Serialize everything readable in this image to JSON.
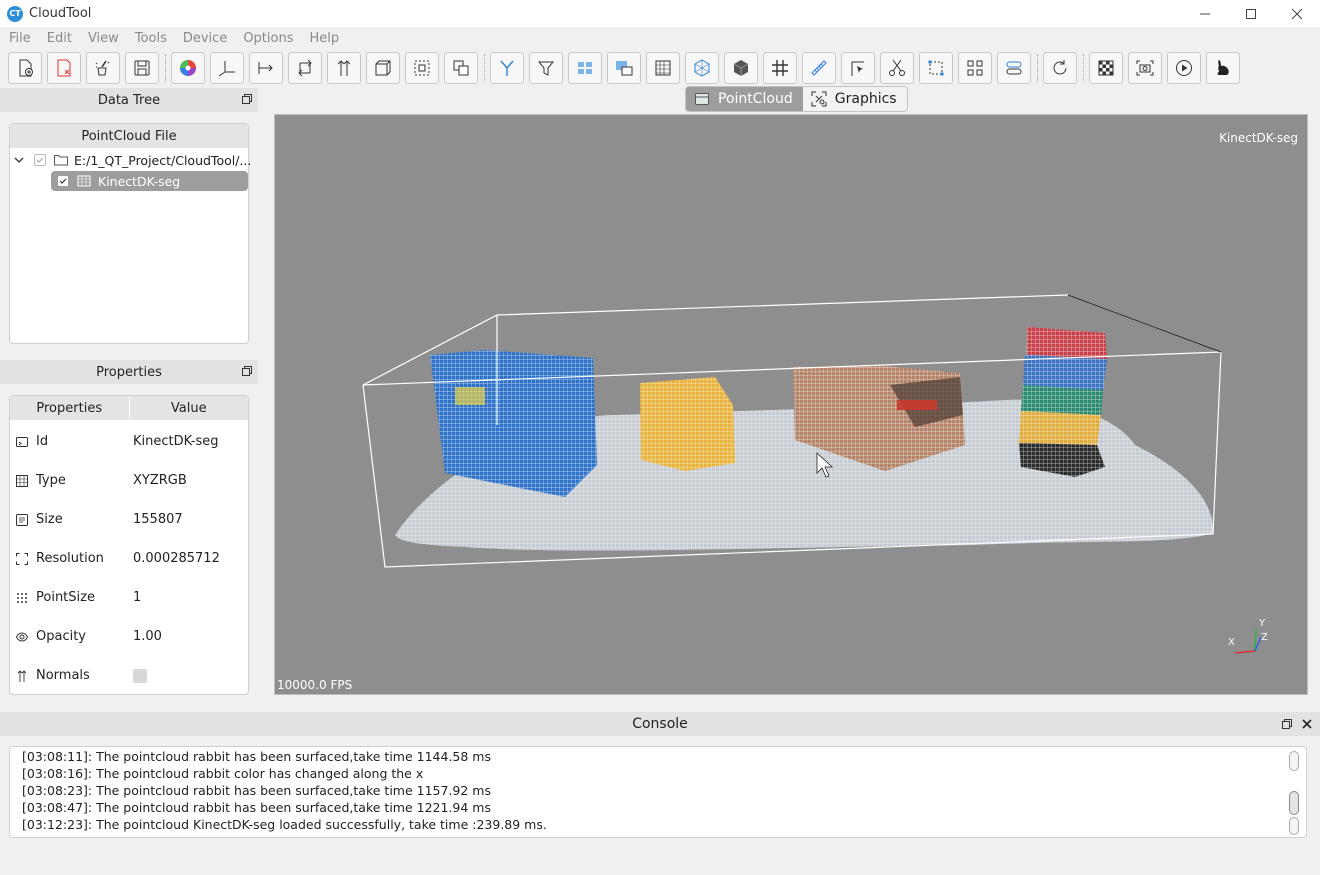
{
  "window": {
    "title": "CloudTool",
    "logo_text": "CT"
  },
  "menu": [
    "File",
    "Edit",
    "View",
    "Tools",
    "Device",
    "Options",
    "Help"
  ],
  "toolbar": {
    "groups": [
      [
        "new-file-icon",
        "close-file-icon",
        "clear-brush-icon",
        "save-icon"
      ],
      [
        "color-wheel-icon",
        "axes-icon",
        "flip-icon",
        "transform-icon",
        "normals-icon",
        "bounding-box-icon",
        "fit-view-icon",
        "clone-icon"
      ],
      [
        "filter-funnel-icon",
        "filter-icon",
        "grid-view-icon",
        "capture-icon",
        "table-icon",
        "polygon-icon",
        "cube-icon",
        "grid-icon",
        "measure-icon",
        "pick-point-icon",
        "cut-icon",
        "select-region-icon",
        "segment-icon",
        "link-icon"
      ],
      [
        "refresh-icon"
      ],
      [
        "checker-icon",
        "camera-icon",
        "play-icon",
        "rabbit-icon"
      ]
    ]
  },
  "data_tree": {
    "title": "Data Tree",
    "header": "PointCloud File",
    "root_label": "E:/1_QT_Project/CloudTool/...",
    "child_label": "KinectDK-seg"
  },
  "properties": {
    "title": "Properties",
    "col_property": "Properties",
    "col_value": "Value",
    "rows": [
      {
        "name": "Id",
        "value": "KinectDK-seg",
        "icon": "id-icon"
      },
      {
        "name": "Type",
        "value": "XYZRGB",
        "icon": "type-icon"
      },
      {
        "name": "Size",
        "value": "155807",
        "icon": "size-icon"
      },
      {
        "name": "Resolution",
        "value": "0.000285712",
        "icon": "resolution-icon"
      },
      {
        "name": "PointSize",
        "value": "1",
        "icon": "point-size-icon"
      },
      {
        "name": "Opacity",
        "value": "1.00",
        "icon": "eye-icon"
      },
      {
        "name": "Normals",
        "value": "",
        "icon": "normals-icon"
      }
    ]
  },
  "viewer": {
    "tabs": [
      "PointCloud",
      "Graphics"
    ],
    "active_tab": "PointCloud",
    "cloud_label": "KinectDK-seg",
    "fps": "10000.0 FPS",
    "axis_labels": {
      "x": "X",
      "y": "Y",
      "z": "Z"
    },
    "background": "#8e8e8e"
  },
  "console": {
    "title": "Console",
    "lines": [
      "[03:08:11]: The pointcloud rabbit has been surfaced,take time 1144.58 ms",
      "[03:08:16]: The pointcloud rabbit color has changed along the x",
      "[03:08:23]: The pointcloud rabbit has been surfaced,take time 1157.92 ms",
      "[03:08:47]: The pointcloud rabbit has been surfaced,take time 1221.94 ms",
      "[03:12:23]: The pointcloud KinectDK-seg loaded successfully, take time :239.89 ms."
    ]
  }
}
